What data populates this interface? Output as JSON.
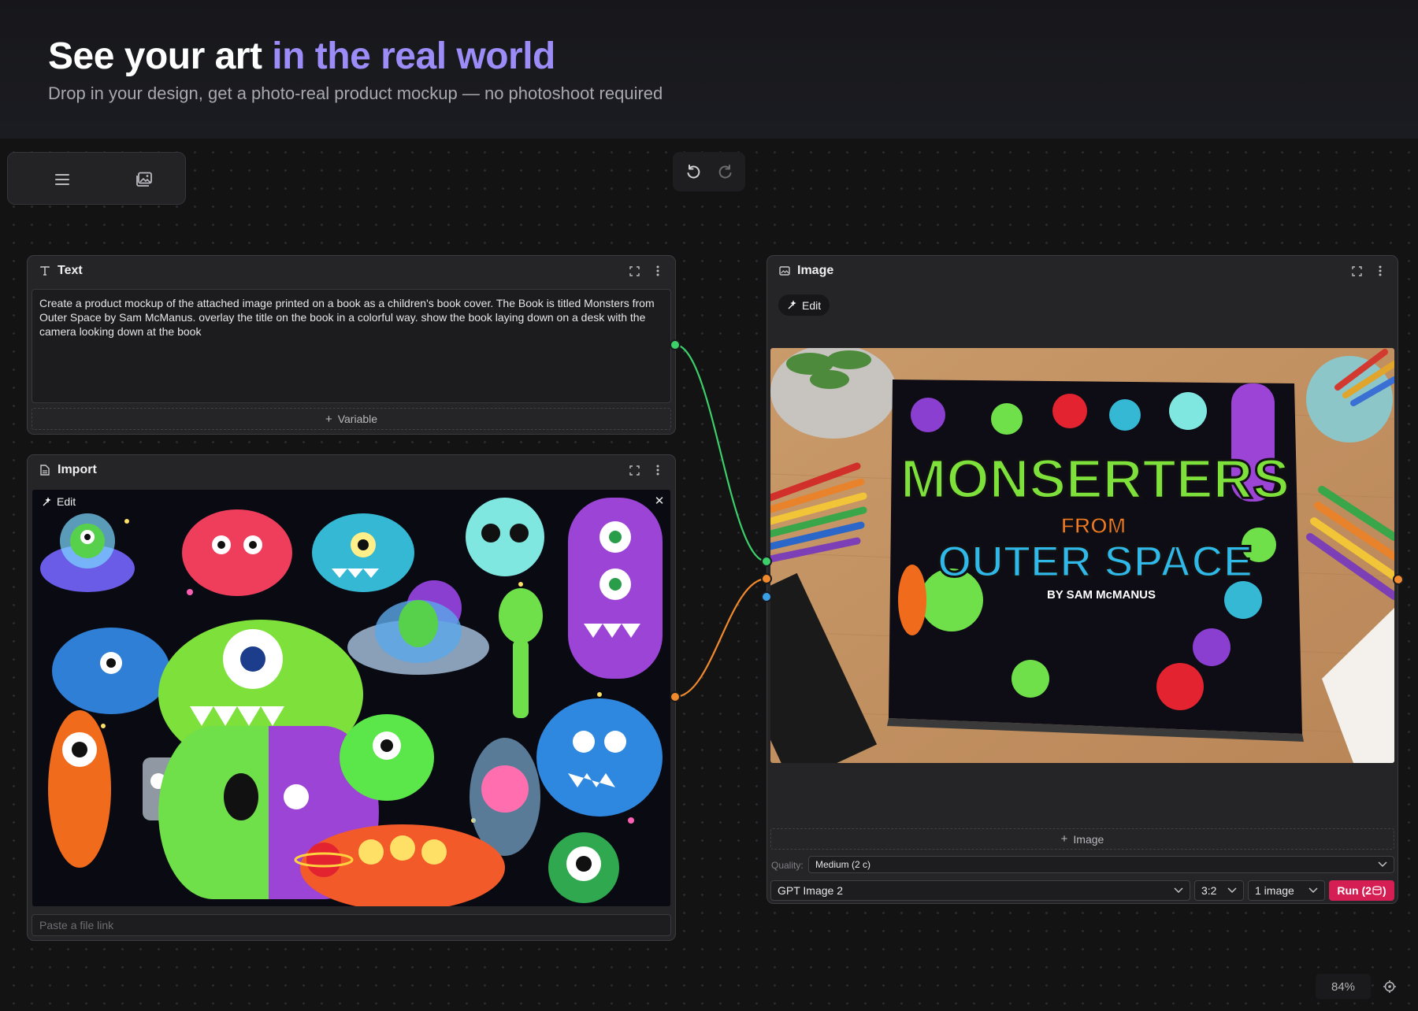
{
  "hero": {
    "title_plain": "See your art",
    "title_accent": "in the real world",
    "subtitle": "Drop in your design, get a photo-real product mockup — no photoshoot required"
  },
  "toolbar": {
    "menu_icon": "menu-icon",
    "gallery_icon": "gallery-icon"
  },
  "history": {
    "undo_icon": "undo-icon",
    "redo_icon": "redo-icon"
  },
  "text_node": {
    "title": "Text",
    "prompt": "Create a product mockup of the attached image printed on a book as a children's book cover. The Book is titled Monsters from Outer Space by Sam McManus. overlay the title on the book in a colorful way. show the book laying down on a desk with the camera looking down at the book",
    "variable_label": "Variable"
  },
  "import_node": {
    "title": "Import",
    "edit_label": "Edit",
    "link_placeholder": "Paste a file link"
  },
  "image_node": {
    "title": "Image",
    "edit_label": "Edit",
    "add_image_label": "Image",
    "quality_label": "Quality:",
    "quality_value": "Medium (2 c)",
    "model_value": "GPT Image 2",
    "ratio_value": "3:2",
    "count_value": "1 image",
    "run_label": "Run (2 ",
    "run_suffix": ")",
    "book_title_line1": "MONSERTERS",
    "book_title_line2": "FROM",
    "book_title_line3": "OUTER SPACE",
    "book_author": "BY SAM McMANUS"
  },
  "zoom": {
    "level": "84%"
  },
  "colors": {
    "accent": "#9b8cf7",
    "run": "#d41e54",
    "wire_green": "#3ccf6a",
    "wire_orange": "#f08a2c",
    "port_blue": "#3aa0e8"
  }
}
